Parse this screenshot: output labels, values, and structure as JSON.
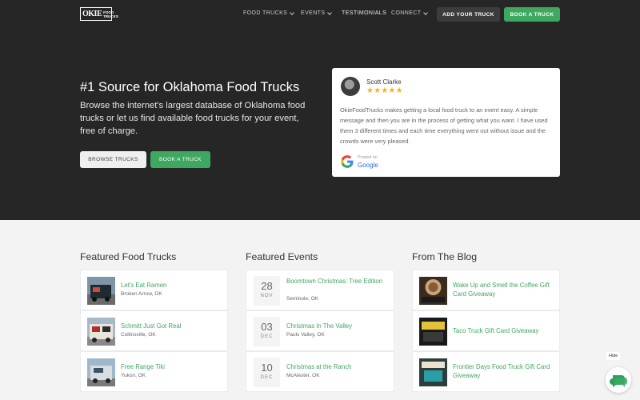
{
  "header": {
    "logo_text": "OKIE",
    "logo_sub": "FOOD TRUCKS",
    "nav": [
      {
        "label": "FOOD TRUCKS",
        "dropdown": true
      },
      {
        "label": "EVENTS",
        "dropdown": true
      },
      {
        "label": "TESTIMONIALS",
        "dropdown": false
      },
      {
        "label": "CONNECT",
        "dropdown": true
      }
    ],
    "add_truck_label": "ADD YOUR TRUCK",
    "book_truck_label": "BOOK A TRUCK"
  },
  "hero": {
    "title": "#1 Source for Oklahoma Food Trucks",
    "description": "Browse the internet's largest database of Oklahoma food trucks or let us find available food trucks for your event, free of charge.",
    "browse_label": "BROWSE TRUCKS",
    "book_label": "BOOK A TRUCK"
  },
  "review": {
    "name": "Scott Clarke",
    "rating": 5,
    "stars": "★★★★★",
    "text": "OkieFoodTrucks makes getting a local food truck to an event easy. A simple message and then you are in the process of getting what you want. I have used them 3 different times and each time everything went out without issue and the crowds were very pleased.",
    "posted_on": "Posted on",
    "source": "Google"
  },
  "featured_trucks": {
    "title": "Featured Food Trucks",
    "items": [
      {
        "name": "Let's Eat Ramen",
        "location": "Broken Arrow, OK"
      },
      {
        "name": "Schmitt Just Got Real",
        "location": "Collinsville, OK"
      },
      {
        "name": "Free Range Tiki",
        "location": "Yukon, OK"
      }
    ]
  },
  "featured_events": {
    "title": "Featured Events",
    "items": [
      {
        "day": "28",
        "month": "NOV",
        "name": "Boomtown Christmas: Tree Edition",
        "location": "Seminole, OK"
      },
      {
        "day": "03",
        "month": "DEC",
        "name": "Christmas In The Valley",
        "location": "Pauls Valley, OK"
      },
      {
        "day": "10",
        "month": "DEC",
        "name": "Christmas at the Ranch",
        "location": "McAlester, OK"
      }
    ]
  },
  "blog": {
    "title": "From The Blog",
    "items": [
      {
        "title": "Wake Up and Smell the Coffee Gift Card Giveaway"
      },
      {
        "title": "Taco Truck Gift Card Giveaway"
      },
      {
        "title": "Frontier Days Food Truck Gift Card Giveaway"
      }
    ]
  },
  "chat_widget": {
    "hide_label": "Hide"
  },
  "colors": {
    "accent": "#3ea860",
    "hero_bg": "#262626",
    "stars": "#f6b01e"
  }
}
